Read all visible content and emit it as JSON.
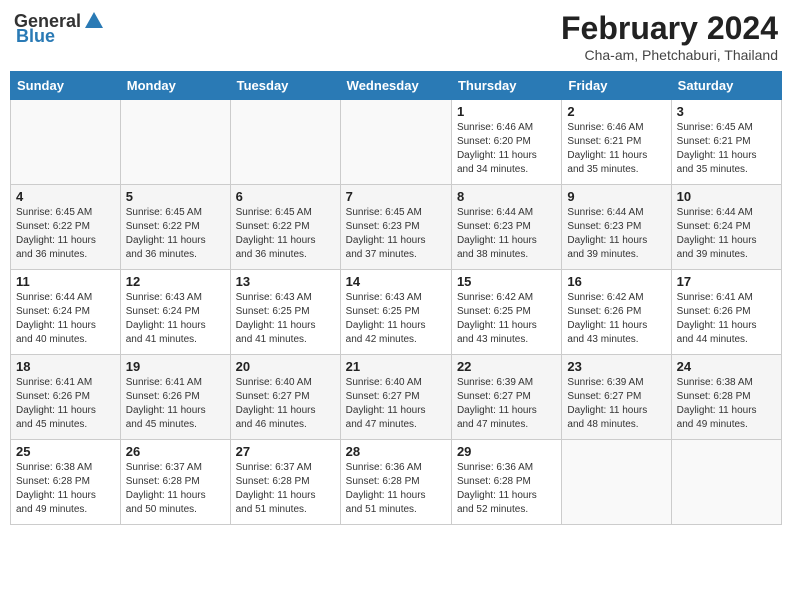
{
  "header": {
    "logo_general": "General",
    "logo_blue": "Blue",
    "month_year": "February 2024",
    "location": "Cha-am, Phetchaburi, Thailand"
  },
  "weekdays": [
    "Sunday",
    "Monday",
    "Tuesday",
    "Wednesday",
    "Thursday",
    "Friday",
    "Saturday"
  ],
  "weeks": [
    [
      {
        "day": "",
        "info": ""
      },
      {
        "day": "",
        "info": ""
      },
      {
        "day": "",
        "info": ""
      },
      {
        "day": "",
        "info": ""
      },
      {
        "day": "1",
        "info": "Sunrise: 6:46 AM\nSunset: 6:20 PM\nDaylight: 11 hours\nand 34 minutes."
      },
      {
        "day": "2",
        "info": "Sunrise: 6:46 AM\nSunset: 6:21 PM\nDaylight: 11 hours\nand 35 minutes."
      },
      {
        "day": "3",
        "info": "Sunrise: 6:45 AM\nSunset: 6:21 PM\nDaylight: 11 hours\nand 35 minutes."
      }
    ],
    [
      {
        "day": "4",
        "info": "Sunrise: 6:45 AM\nSunset: 6:22 PM\nDaylight: 11 hours\nand 36 minutes."
      },
      {
        "day": "5",
        "info": "Sunrise: 6:45 AM\nSunset: 6:22 PM\nDaylight: 11 hours\nand 36 minutes."
      },
      {
        "day": "6",
        "info": "Sunrise: 6:45 AM\nSunset: 6:22 PM\nDaylight: 11 hours\nand 36 minutes."
      },
      {
        "day": "7",
        "info": "Sunrise: 6:45 AM\nSunset: 6:23 PM\nDaylight: 11 hours\nand 37 minutes."
      },
      {
        "day": "8",
        "info": "Sunrise: 6:44 AM\nSunset: 6:23 PM\nDaylight: 11 hours\nand 38 minutes."
      },
      {
        "day": "9",
        "info": "Sunrise: 6:44 AM\nSunset: 6:23 PM\nDaylight: 11 hours\nand 39 minutes."
      },
      {
        "day": "10",
        "info": "Sunrise: 6:44 AM\nSunset: 6:24 PM\nDaylight: 11 hours\nand 39 minutes."
      }
    ],
    [
      {
        "day": "11",
        "info": "Sunrise: 6:44 AM\nSunset: 6:24 PM\nDaylight: 11 hours\nand 40 minutes."
      },
      {
        "day": "12",
        "info": "Sunrise: 6:43 AM\nSunset: 6:24 PM\nDaylight: 11 hours\nand 41 minutes."
      },
      {
        "day": "13",
        "info": "Sunrise: 6:43 AM\nSunset: 6:25 PM\nDaylight: 11 hours\nand 41 minutes."
      },
      {
        "day": "14",
        "info": "Sunrise: 6:43 AM\nSunset: 6:25 PM\nDaylight: 11 hours\nand 42 minutes."
      },
      {
        "day": "15",
        "info": "Sunrise: 6:42 AM\nSunset: 6:25 PM\nDaylight: 11 hours\nand 43 minutes."
      },
      {
        "day": "16",
        "info": "Sunrise: 6:42 AM\nSunset: 6:26 PM\nDaylight: 11 hours\nand 43 minutes."
      },
      {
        "day": "17",
        "info": "Sunrise: 6:41 AM\nSunset: 6:26 PM\nDaylight: 11 hours\nand 44 minutes."
      }
    ],
    [
      {
        "day": "18",
        "info": "Sunrise: 6:41 AM\nSunset: 6:26 PM\nDaylight: 11 hours\nand 45 minutes."
      },
      {
        "day": "19",
        "info": "Sunrise: 6:41 AM\nSunset: 6:26 PM\nDaylight: 11 hours\nand 45 minutes."
      },
      {
        "day": "20",
        "info": "Sunrise: 6:40 AM\nSunset: 6:27 PM\nDaylight: 11 hours\nand 46 minutes."
      },
      {
        "day": "21",
        "info": "Sunrise: 6:40 AM\nSunset: 6:27 PM\nDaylight: 11 hours\nand 47 minutes."
      },
      {
        "day": "22",
        "info": "Sunrise: 6:39 AM\nSunset: 6:27 PM\nDaylight: 11 hours\nand 47 minutes."
      },
      {
        "day": "23",
        "info": "Sunrise: 6:39 AM\nSunset: 6:27 PM\nDaylight: 11 hours\nand 48 minutes."
      },
      {
        "day": "24",
        "info": "Sunrise: 6:38 AM\nSunset: 6:28 PM\nDaylight: 11 hours\nand 49 minutes."
      }
    ],
    [
      {
        "day": "25",
        "info": "Sunrise: 6:38 AM\nSunset: 6:28 PM\nDaylight: 11 hours\nand 49 minutes."
      },
      {
        "day": "26",
        "info": "Sunrise: 6:37 AM\nSunset: 6:28 PM\nDaylight: 11 hours\nand 50 minutes."
      },
      {
        "day": "27",
        "info": "Sunrise: 6:37 AM\nSunset: 6:28 PM\nDaylight: 11 hours\nand 51 minutes."
      },
      {
        "day": "28",
        "info": "Sunrise: 6:36 AM\nSunset: 6:28 PM\nDaylight: 11 hours\nand 51 minutes."
      },
      {
        "day": "29",
        "info": "Sunrise: 6:36 AM\nSunset: 6:28 PM\nDaylight: 11 hours\nand 52 minutes."
      },
      {
        "day": "",
        "info": ""
      },
      {
        "day": "",
        "info": ""
      }
    ]
  ]
}
